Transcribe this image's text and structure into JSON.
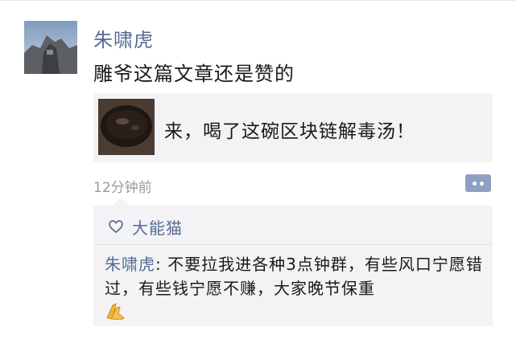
{
  "post": {
    "author": "朱啸虎",
    "text": "雕爷这篇文章还是赞的",
    "shared_link": {
      "title": "来，喝了这碗区块链解毒汤！"
    },
    "timestamp": "12分钟前"
  },
  "likes": {
    "names": "大能猫"
  },
  "comments": [
    {
      "author": "朱啸虎",
      "separator": ": ",
      "text": "不要拉我进各种3点钟群，有些风口宁愿错过，有些钱宁愿不赚，大家晚节保重",
      "emoji": "clasped-hands-emoji"
    }
  ],
  "icons": {
    "like": "heart-outline-icon",
    "more": "comment-more-icon"
  },
  "colors": {
    "link_blue": "#576b95",
    "card_bg": "#f3f3f5",
    "time_gray": "#9a9a9a"
  }
}
